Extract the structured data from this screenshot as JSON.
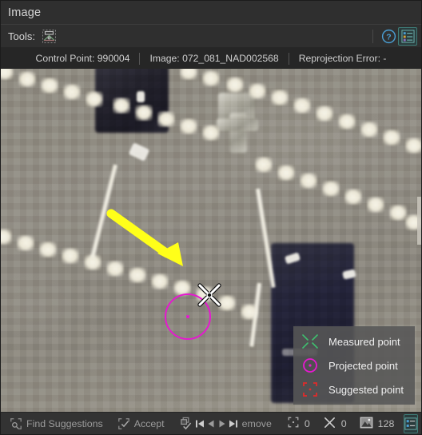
{
  "window": {
    "title": "Image"
  },
  "toolbar": {
    "tools_label": "Tools:",
    "measure_tool_icon": "tie-point-measure-icon",
    "help_icon": "help-circle-icon",
    "legend_toggle_icon": "legend-list-icon"
  },
  "info": {
    "control_point": "Control Point: 990004",
    "image": "Image: 072_081_NAD002568",
    "reprojection_error": "Reprojection Error: -"
  },
  "legend": {
    "items": [
      {
        "label": "Measured point",
        "icon": "measured-point-x-icon",
        "color": "#3fbf6f"
      },
      {
        "label": "Projected point",
        "icon": "projected-point-circle-icon",
        "color": "#e519cf"
      },
      {
        "label": "Suggested point",
        "icon": "suggested-point-bracket-icon",
        "color": "#e02b2b"
      }
    ]
  },
  "canvas": {
    "cursor_icon": "measure-crosshair-cursor",
    "annotation_arrow_icon": "yellow-pointer-arrow",
    "annotation_arrow_color": "#ffff19",
    "projected_point_color": "#e519cf",
    "content_description": "Zoomed aerial imagery of a parking lot with white dashed parking stripes and parked vehicles"
  },
  "statusbar": {
    "find_suggestions_label": "Find Suggestions",
    "find_suggestions_icon": "find-suggestions-icon",
    "accept_label": "Accept",
    "accept_icon": "accept-check-icon",
    "remove_label": "emove",
    "remove_icon": "remove-point-icon",
    "nav": [
      {
        "icon": "first-point-icon",
        "name": "first"
      },
      {
        "icon": "previous-point-icon",
        "name": "previous"
      },
      {
        "icon": "next-point-icon",
        "name": "next"
      },
      {
        "icon": "last-point-icon",
        "name": "last"
      }
    ],
    "counts": [
      {
        "icon": "suggested-count-icon",
        "value": "0"
      },
      {
        "icon": "measured-count-icon",
        "value": "0"
      },
      {
        "icon": "image-count-icon",
        "value": "128"
      }
    ],
    "legend_toggle_icon": "legend-list-icon"
  }
}
